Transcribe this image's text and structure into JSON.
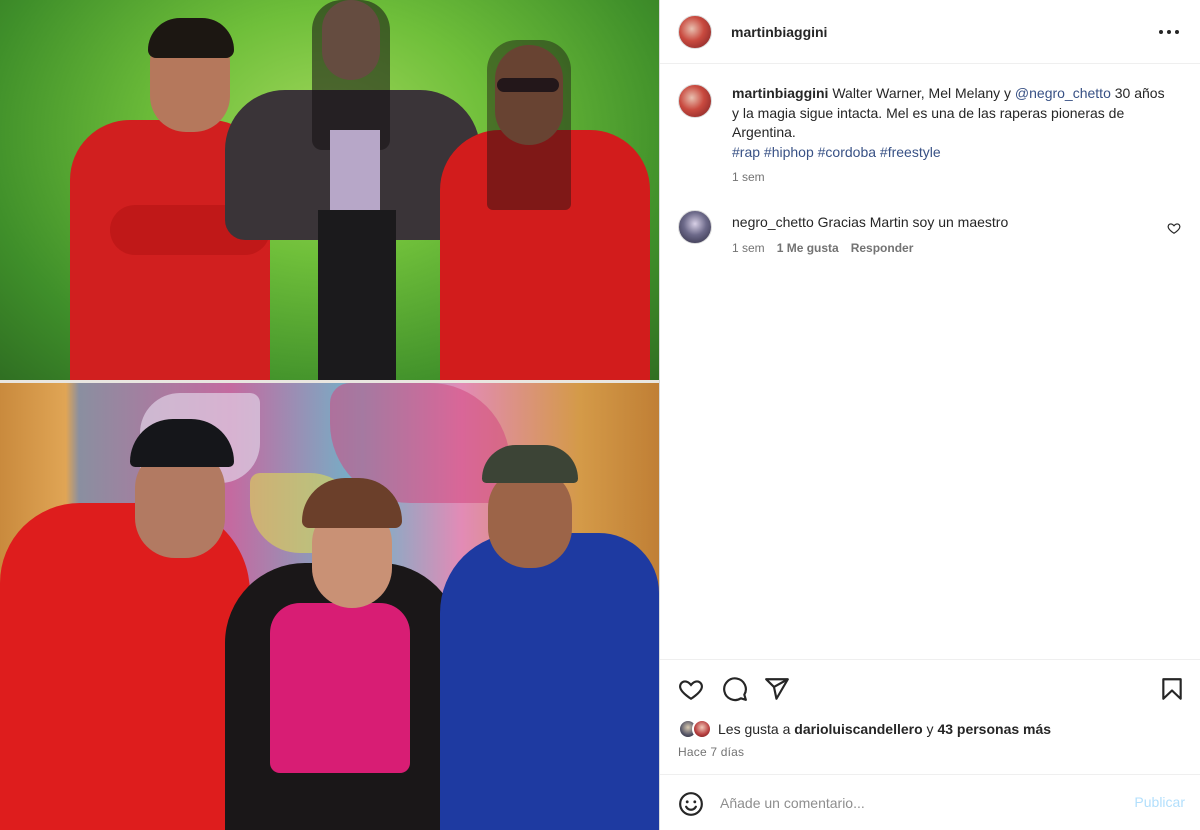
{
  "post": {
    "author": "martinbiaggini",
    "more_icon": "more-horizontal-icon"
  },
  "caption": {
    "username": "martinbiaggini",
    "text_before_mention": "Walter Warner, Mel Melany y ",
    "mention": "@negro_chetto",
    "text_after_mention": " 30 años y la magia sigue intacta. Mel es una de las raperas pioneras de Argentina.",
    "hashtags": [
      "#rap",
      "#hiphop",
      "#cordoba",
      "#freestyle"
    ],
    "time": "1 sem"
  },
  "comments": [
    {
      "username": "negro_chetto",
      "text": "Gracias Martin soy un maestro",
      "time": "1 sem",
      "likes": "1 Me gusta",
      "reply_label": "Responder"
    }
  ],
  "actions": {
    "like_icon": "heart-icon",
    "comment_icon": "comment-icon",
    "share_icon": "send-icon",
    "save_icon": "bookmark-icon"
  },
  "likes": {
    "prefix": "Les gusta a ",
    "user": "darioluiscandellero",
    "connector": " y ",
    "others": "43 personas más"
  },
  "post_time": "Hace 7 días",
  "comment_box": {
    "placeholder": "Añade un comentario...",
    "publish_label": "Publicar",
    "emoji_icon": "emoji-icon"
  },
  "colors": {
    "link": "#385185",
    "publish_disabled": "#b2dffc",
    "secondary_text": "#737373",
    "border": "#dbdbdb"
  }
}
